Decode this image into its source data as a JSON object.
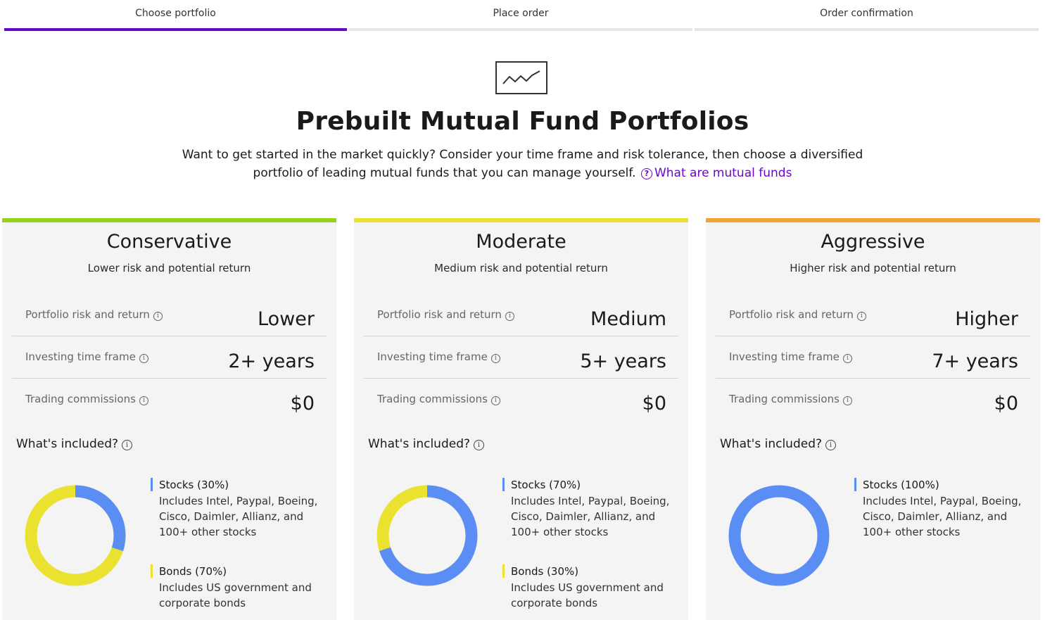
{
  "stepper": {
    "steps": [
      {
        "label": "Choose portfolio"
      },
      {
        "label": "Place order"
      },
      {
        "label": "Order confirmation"
      }
    ]
  },
  "colors": {
    "accent": "#6a06c8",
    "conservative": "#97d21a",
    "moderate": "#ebe230",
    "aggressive": "#f0a534",
    "stocks": "#5b8ef5",
    "bonds": "#ebe230"
  },
  "header": {
    "icon": "line-chart-icon",
    "title": "Prebuilt Mutual Fund Portfolios",
    "intro_text": "Want to get started in the market quickly? Consider your time frame and risk tolerance, then choose a diversified portfolio of leading mutual funds that you can manage yourself.",
    "help_icon": "?",
    "help_link": "What are mutual funds"
  },
  "cards": [
    {
      "title": "Conservative",
      "subtitle": "Lower risk and potential return",
      "risk_label": "Portfolio risk and return",
      "risk_value": "Lower",
      "time_label": "Investing time frame",
      "time_value": "2+ years",
      "commission_label": "Trading commissions",
      "commission_value": "$0",
      "included_label": "What's included?",
      "stocks_name": "Stocks (30%)",
      "stocks_desc": "Includes Intel, Paypal, Boeing, Cisco, Daimler, Allianz, and 100+ other stocks",
      "bonds_name": "Bonds (70%)",
      "bonds_desc": "Includes US government and corporate bonds",
      "stocks_pct": 30,
      "bonds_pct": 70
    },
    {
      "title": "Moderate",
      "subtitle": "Medium risk and potential return",
      "risk_label": "Portfolio risk and return",
      "risk_value": "Medium",
      "time_label": "Investing time frame",
      "time_value": "5+ years",
      "commission_label": "Trading commissions",
      "commission_value": "$0",
      "included_label": "What's included?",
      "stocks_name": "Stocks (70%)",
      "stocks_desc": "Includes Intel, Paypal, Boeing, Cisco, Daimler, Allianz, and 100+ other stocks",
      "bonds_name": "Bonds (30%)",
      "bonds_desc": "Includes US government and corporate bonds",
      "stocks_pct": 70,
      "bonds_pct": 30
    },
    {
      "title": "Aggressive",
      "subtitle": "Higher risk and potential return",
      "risk_label": "Portfolio risk and return",
      "risk_value": "Higher",
      "time_label": "Investing time frame",
      "time_value": "7+ years",
      "commission_label": "Trading commissions",
      "commission_value": "$0",
      "included_label": "What's included?",
      "stocks_name": "Stocks (100%)",
      "stocks_desc": "Includes Intel, Paypal, Boeing, Cisco, Daimler, Allianz, and 100+ other stocks",
      "stocks_pct": 100,
      "bonds_pct": 0
    }
  ]
}
